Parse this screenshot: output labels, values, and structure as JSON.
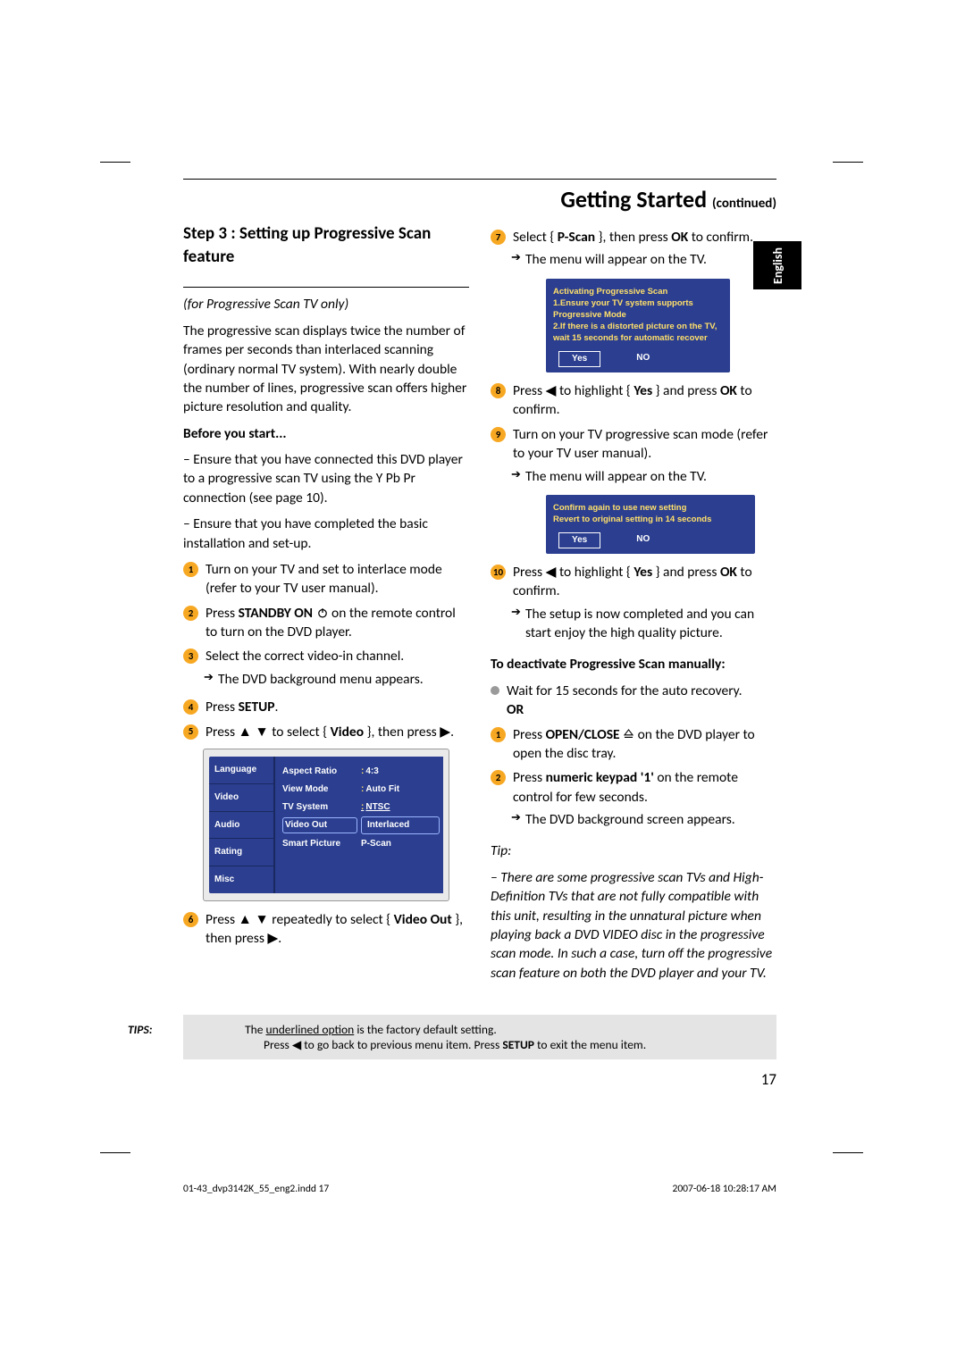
{
  "header": {
    "title": "Getting Started",
    "cont": "(continued)"
  },
  "lang_tab": "English",
  "left": {
    "step_title": "Step 3 :  Setting up Progressive Scan feature",
    "italic_note": "(for Progressive Scan TV only)",
    "intro": "The progressive scan displays twice the number of frames per seconds than interlaced scanning (ordinary normal TV system). With nearly double the number of lines, progressive scan offers higher picture resolution and quality.",
    "before_head": "Before you start...",
    "before_1": "– Ensure that you have connected this DVD player to a progressive scan TV using the Y Pb Pr connection (see page 10).",
    "before_2": "– Ensure that you have completed the basic installation and set-up.",
    "s1": "Turn on your TV and set to interlace mode (refer to your TV user manual).",
    "s2_pre": "Press ",
    "s2_bold": "STANDBY ON",
    "s2_post": " on the remote control to turn on the DVD player.",
    "s3": "Select the correct video-in channel.",
    "s3_sub": "The DVD background menu appears.",
    "s4_pre": "Press ",
    "s4_bold": "SETUP",
    "s4_post": ".",
    "s5_pre": "Press ▲ ▼ to select { ",
    "s5_bold": "Video",
    "s5_post": " }, then press ▶.",
    "osd": {
      "tabs": [
        "Language",
        "Video",
        "Audio",
        "Rating",
        "Misc"
      ],
      "fields": [
        {
          "label": "Aspect Ratio",
          "lead": ":",
          "value": "4:3"
        },
        {
          "label": "View Mode",
          "lead": ":",
          "value": "Auto Fit"
        },
        {
          "label": "TV System",
          "lead": ":",
          "value": "NTSC",
          "ntsc": true
        },
        {
          "label": "Video Out",
          "value": "Interlaced",
          "box": true
        },
        {
          "label": "Smart Picture",
          "value": "P-Scan"
        }
      ]
    },
    "s6_pre": "Press ▲ ▼ repeatedly to select { ",
    "s6_bold": "Video Out",
    "s6_post": " }, then press ▶."
  },
  "right": {
    "s7_pre": "Select { ",
    "s7_bold": "P-Scan",
    "s7_mid": " }, then press ",
    "s7_bold2": "OK",
    "s7_post": " to confirm.",
    "s7_sub": "The menu will appear on the TV.",
    "dlg1": {
      "head": "Activating Progressive Scan",
      "l1": "1.Ensure your TV system supports Progressive Mode",
      "l2": "2.If there is a distorted picture on the TV, wait 15 seconds for automatic recover",
      "yes": "Yes",
      "no": "NO"
    },
    "s8_pre": "Press ◀ to highlight { ",
    "s8_bold": "Yes",
    "s8_mid": " } and press ",
    "s8_bold2": "OK",
    "s8_post": " to confirm.",
    "s9": "Turn on your TV progressive scan mode (refer to your TV user manual).",
    "s9_sub": "The menu will appear on the TV.",
    "dlg2": {
      "l1": "Confirm again to use new setting",
      "l2": "Revert to original setting in 14 seconds",
      "yes": "Yes",
      "no": "NO"
    },
    "s10_pre": "Press ◀ to highlight { ",
    "s10_bold": "Yes",
    "s10_mid": " } and press ",
    "s10_bold2": "OK",
    "s10_post": " to confirm.",
    "s10_sub": "The setup is now completed and you can start enjoy the high quality picture.",
    "deact_head": "To deactivate Progressive Scan manually:",
    "deact_b1": "Wait for 15 seconds for the auto recovery.",
    "or": "OR",
    "d1_pre": "Press ",
    "d1_bold": "OPEN/CLOSE",
    "d1_post": " on the DVD player to open the disc tray.",
    "d2_pre": "Press ",
    "d2_bold": "numeric keypad '1'",
    "d2_post": " on the remote control for few seconds.",
    "d2_sub": "The DVD background screen appears.",
    "tip_head": "Tip:",
    "tip_body": "– There are some progressive scan TVs and High-Definition TVs that are not fully compatible with this unit, resulting in the unnatural picture when playing back a DVD VIDEO disc in the progressive scan mode. In such a case, turn off the progressive scan feature on both the DVD player and your TV."
  },
  "tips_box": {
    "label": "TIPS:",
    "l1a": "The ",
    "l1u": "underlined option",
    "l1b": " is the factory default setting.",
    "l2a": "Press ◀ to go back to previous menu item. Press ",
    "l2b": "SETUP",
    "l2c": " to exit the menu item."
  },
  "page_number": "17",
  "footer": {
    "left": "01-43_dvp3142K_55_eng2.indd   17",
    "right": "2007-06-18   10:28:17 AM"
  }
}
